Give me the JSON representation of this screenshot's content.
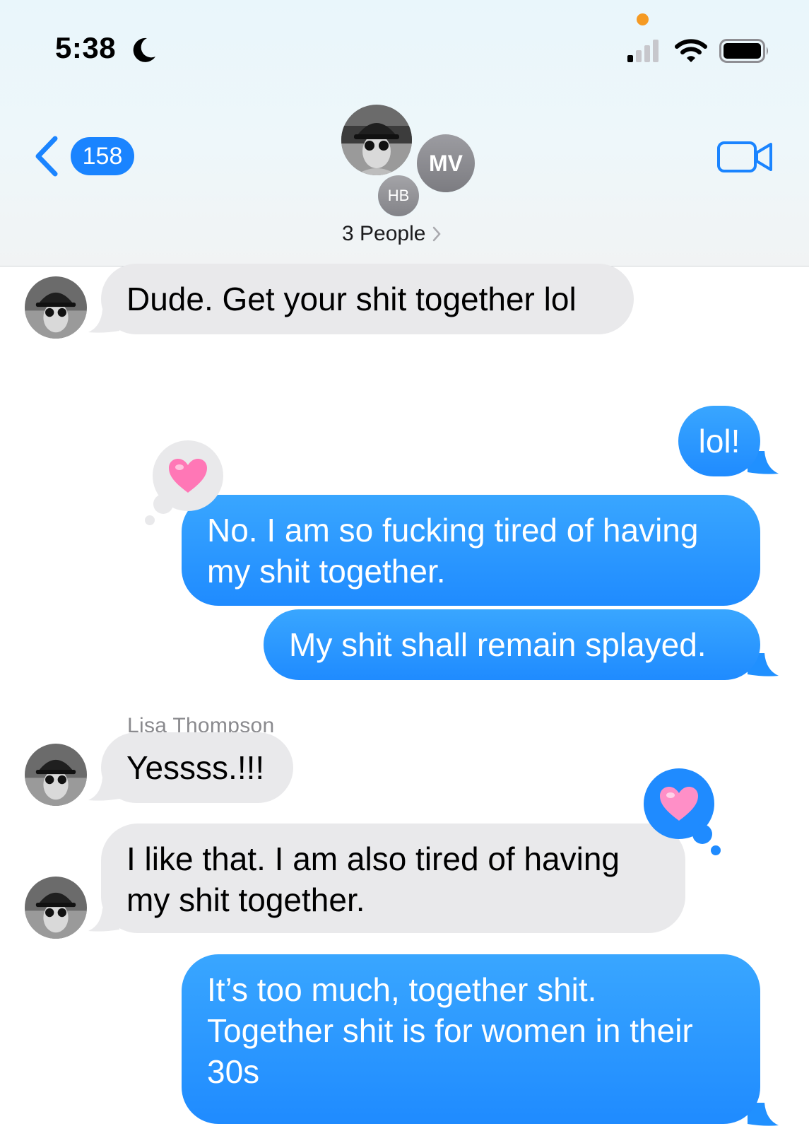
{
  "status_bar": {
    "time": "5:38",
    "do_not_disturb": true,
    "mic_indicator_color": "#f59a23"
  },
  "nav": {
    "back_count": "158",
    "video_icon": "video-camera-icon"
  },
  "group": {
    "participants": [
      "MV",
      "HB"
    ],
    "label": "3 People"
  },
  "colors": {
    "outgoing_bubble": "#1f8bff",
    "incoming_bubble": "#e9e9eb",
    "accent": "#1a84ff"
  },
  "messages": [
    {
      "direction": "incoming",
      "text": "Dude. Get your shit together lol"
    },
    {
      "direction": "outgoing",
      "text": "lol!"
    },
    {
      "direction": "outgoing",
      "text": "No. I am so fucking tired of having\nmy shit together.",
      "reaction": "heart"
    },
    {
      "direction": "outgoing",
      "text": "My shit shall remain splayed."
    },
    {
      "direction": "incoming",
      "sender": "Lisa Thompson",
      "text": "Yessss.!!!"
    },
    {
      "direction": "incoming",
      "text": "I like that. I am also tired of having\nmy shit together.",
      "reaction": "heart"
    },
    {
      "direction": "outgoing",
      "text": "It’s too much, together shit.\nTogether shit is for women in their\n30s"
    }
  ]
}
